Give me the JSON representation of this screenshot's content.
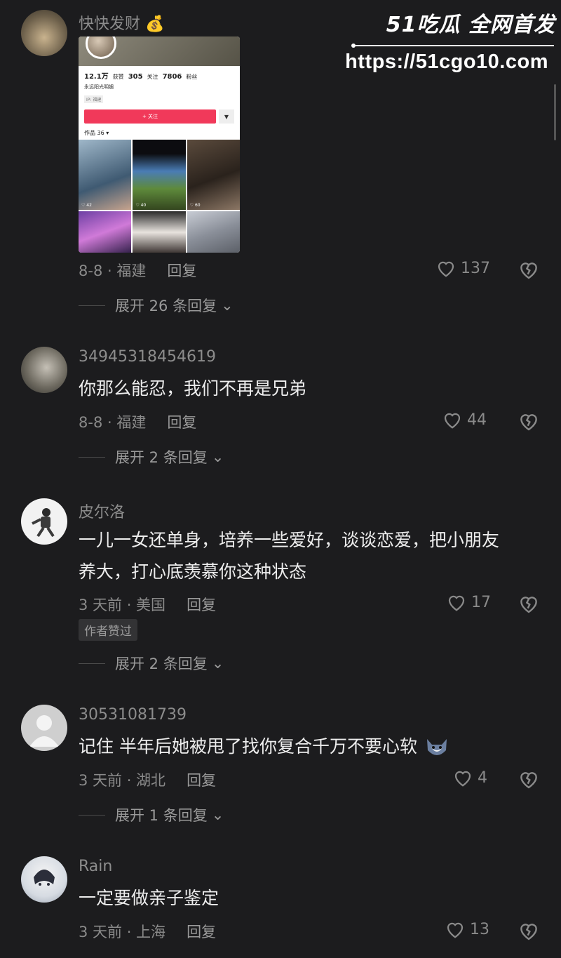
{
  "watermark": {
    "brand": "51吃瓜 全网首发",
    "url": "https://51cgo10.com"
  },
  "comments": [
    {
      "username": "快快发财 💰",
      "image": {
        "stats": [
          "12.1万",
          "获赞",
          "305",
          "关注",
          "7806",
          "粉丝"
        ],
        "bio": "永远阳光明媚",
        "ip": "IP: 福建",
        "follow": "+ 关注",
        "tab": "作品 36 ▾",
        "likes": [
          "♡ 42",
          "♡ 40",
          "♡ 60"
        ]
      },
      "date": "8-8 · 福建",
      "reply": "回复",
      "likes": "137",
      "expand": "展开 26 条回复"
    },
    {
      "username": "34945318454619",
      "text": "你那么能忍，我们不再是兄弟",
      "date": "8-8 · 福建",
      "reply": "回复",
      "likes": "44",
      "expand": "展开 2 条回复"
    },
    {
      "username": "皮尔洛",
      "text_line1": "一儿一女还单身，培养一些爱好，谈谈恋爱，把小朋友",
      "text_line2": "养大，打心底羡慕你这种状态",
      "date": "3 天前 · 美国",
      "reply": "回复",
      "likes": "17",
      "author_liked": "作者赞过",
      "expand": "展开 2 条回复"
    },
    {
      "username": "30531081739",
      "text": "记住  半年后她被甩了找你复合千万不要心软",
      "date": "3 天前 · 湖北",
      "reply": "回复",
      "likes": "4",
      "expand": "展开 1 条回复"
    },
    {
      "username": "Rain",
      "text": "一定要做亲子鉴定",
      "date": "3 天前 · 上海",
      "reply": "回复",
      "likes": "13"
    }
  ]
}
